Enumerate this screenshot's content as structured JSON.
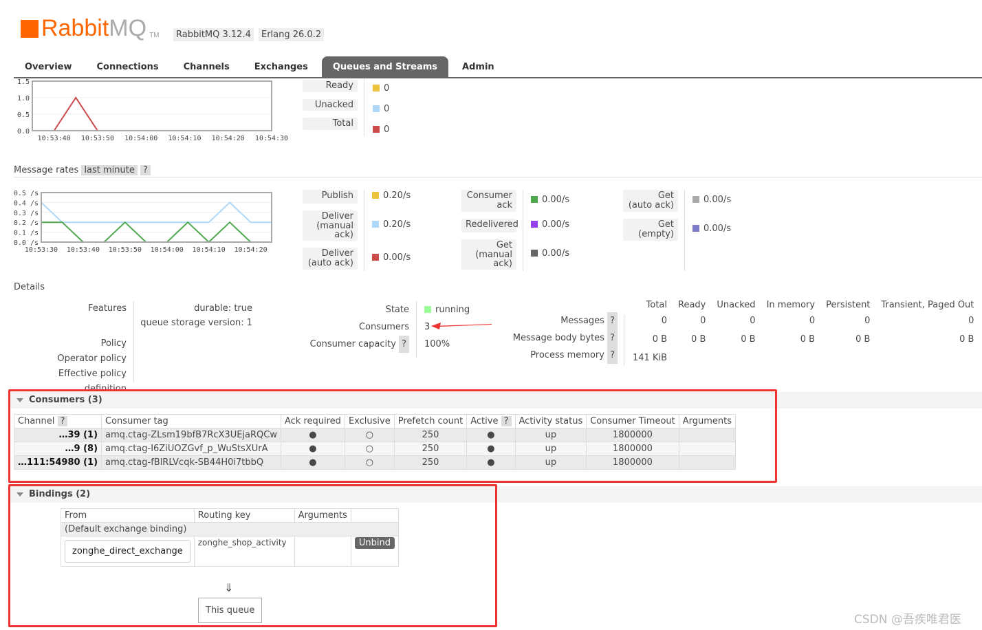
{
  "header": {
    "logo_main": "Rabbit",
    "logo_mq": "MQ",
    "logo_tm": "TM",
    "version": "RabbitMQ 3.12.4",
    "erlang": "Erlang 26.0.2"
  },
  "nav": [
    "Overview",
    "Connections",
    "Channels",
    "Exchanges",
    "Queues and Streams",
    "Admin"
  ],
  "queued": {
    "items": [
      {
        "label": "Ready",
        "value": "0",
        "color": "#edc240"
      },
      {
        "label": "Unacked",
        "value": "0",
        "color": "#afd8f8"
      },
      {
        "label": "Total",
        "value": "0",
        "color": "#cb4b4b"
      }
    ]
  },
  "rates_title": "Message rates",
  "rates_range": "last minute",
  "help": "?",
  "rates": {
    "col1": [
      {
        "label": "Publish",
        "value": "0.20/s",
        "color": "#edc240"
      },
      {
        "label": "Deliver (manual ack)",
        "value": "0.20/s",
        "color": "#afd8f8"
      },
      {
        "label": "Deliver (auto ack)",
        "value": "0.00/s",
        "color": "#cb4b4b"
      }
    ],
    "col2": [
      {
        "label": "Consumer ack",
        "value": "0.00/s",
        "color": "#4da74d"
      },
      {
        "label": "Redelivered",
        "value": "0.00/s",
        "color": "#9440ed"
      },
      {
        "label": "Get (manual ack)",
        "value": "0.00/s",
        "color": "#666666"
      }
    ],
    "col3": [
      {
        "label": "Get (auto ack)",
        "value": "0.00/s",
        "color": "#aaaaaa"
      },
      {
        "label": "Get (empty)",
        "value": "0.00/s",
        "color": "#7c79c9"
      }
    ]
  },
  "chart_data": [
    {
      "type": "line",
      "title": "Queued messages",
      "xlim": [
        0,
        55
      ],
      "ylim": [
        0,
        1.5
      ],
      "yticks": [
        "0.0",
        "0.5",
        "1.0",
        "1.5"
      ],
      "xticks": [
        "10:53:40",
        "10:53:50",
        "10:54:00",
        "10:54:10",
        "10:54:20",
        "10:54:30"
      ],
      "xtick_seconds": [
        5,
        15,
        25,
        35,
        45,
        55
      ],
      "series": [
        {
          "name": "Ready",
          "color": "#edc240",
          "points": [
            [
              5,
              0
            ],
            [
              15,
              0
            ]
          ]
        },
        {
          "name": "Total",
          "color": "#cb4b4b",
          "points": [
            [
              0,
              0
            ],
            [
              5,
              0
            ],
            [
              10,
              1
            ],
            [
              15,
              0
            ],
            [
              55,
              0
            ]
          ]
        }
      ]
    },
    {
      "type": "line",
      "title": "Message rates",
      "xlim": [
        0,
        55
      ],
      "ylim": [
        0,
        0.5
      ],
      "yticks": [
        "0.0 /s",
        "0.1 /s",
        "0.2 /s",
        "0.3 /s",
        "0.4 /s",
        "0.5 /s"
      ],
      "xticks": [
        "10:53:30",
        "10:53:40",
        "10:53:50",
        "10:54:00",
        "10:54:10",
        "10:54:20"
      ],
      "xtick_seconds": [
        0,
        10,
        20,
        30,
        40,
        50
      ],
      "series": [
        {
          "name": "Deliver (manual ack)",
          "color": "#afd8f8",
          "points": [
            [
              0,
              0.4
            ],
            [
              5,
              0.2
            ],
            [
              40,
              0.2
            ],
            [
              45,
              0.4
            ],
            [
              50,
              0.2
            ],
            [
              55,
              0.2
            ]
          ]
        },
        {
          "name": "Consumer ack",
          "color": "#4da74d",
          "points": [
            [
              0,
              0.2
            ],
            [
              5,
              0.2
            ],
            [
              10,
              0
            ],
            [
              15,
              0
            ],
            [
              20,
              0.2
            ],
            [
              25,
              0
            ],
            [
              30,
              0
            ],
            [
              35,
              0.2
            ],
            [
              40,
              0
            ],
            [
              45,
              0.2
            ],
            [
              50,
              0
            ]
          ]
        },
        {
          "name": "Get (empty)",
          "color": "#7c79c9",
          "points": [
            [
              0,
              0
            ],
            [
              55,
              0
            ]
          ]
        }
      ]
    }
  ],
  "details": {
    "title": "Details",
    "features_label": "Features",
    "durable_k": "durable:",
    "durable_v": "true",
    "qsv_k": "queue storage version:",
    "qsv_v": "1",
    "policy": "Policy",
    "op_policy": "Operator policy",
    "eff_policy": "Effective policy definition",
    "state_label": "State",
    "state": "running",
    "consumers_label": "Consumers",
    "consumers": "3",
    "capacity_label": "Consumer capacity",
    "capacity": "100%",
    "cols": [
      "Total",
      "Ready",
      "Unacked",
      "In memory",
      "Persistent",
      "Transient, Paged Out"
    ],
    "messages_label": "Messages",
    "messages": [
      "0",
      "0",
      "0",
      "0",
      "0",
      "0"
    ],
    "bytes_label": "Message body bytes",
    "bytes": [
      "0 B",
      "0 B",
      "0 B",
      "0 B",
      "0 B",
      "0 B"
    ],
    "mem_label": "Process memory",
    "mem": "141 KiB"
  },
  "consumers": {
    "title": "Consumers (3)",
    "headers": [
      "Channel",
      "Consumer tag",
      "Ack required",
      "Exclusive",
      "Prefetch count",
      "Active",
      "Activity status",
      "Consumer Timeout",
      "Arguments"
    ],
    "rows": [
      [
        "…39 (1)",
        "amq.ctag-ZLsm19bfB7RcX3UEjaRQCw",
        "●",
        "○",
        "250",
        "●",
        "up",
        "1800000",
        ""
      ],
      [
        "…9 (8)",
        "amq.ctag-I6ZiUOZGvf_p_WuStsXUrA",
        "●",
        "○",
        "250",
        "●",
        "up",
        "1800000",
        ""
      ],
      [
        "…111:54980 (1)",
        "amq.ctag-fBlRLVcqk-SB44H0i7tbbQ",
        "●",
        "○",
        "250",
        "●",
        "up",
        "1800000",
        ""
      ]
    ]
  },
  "bindings": {
    "title": "Bindings (2)",
    "headers": [
      "From",
      "Routing key",
      "Arguments"
    ],
    "default": "(Default exchange binding)",
    "from": "zonghe_direct_exchange",
    "key": "zonghe_shop_activity",
    "unbind": "Unbind",
    "arrow": "⇓",
    "this_queue": "This queue"
  },
  "watermark": "CSDN @吾疾唯君医"
}
